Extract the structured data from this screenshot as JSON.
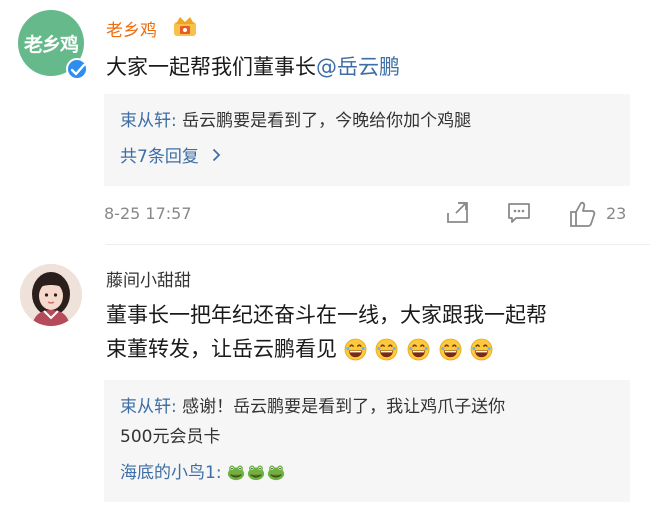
{
  "comments": [
    {
      "username": "老乡鸡",
      "avatar_text": "老乡鸡",
      "content_text": "大家一起帮我们董事长",
      "mention": "@岳云鹏",
      "reply_name": "束从轩:",
      "reply_text": " 岳云鹏要是看到了，今晚给你加个鸡腿",
      "more_replies": "共7条回复",
      "timestamp": "8-25 17:57",
      "like_count": "23"
    },
    {
      "username": "藤间小甜甜",
      "content_line1": "董事长一把年纪还奋斗在一线，大家跟我一起帮",
      "content_line2": "束董转发，让岳云鹏看见",
      "reply_name": "束从轩:",
      "reply_text_line1": " 感谢！岳云鹏要是看到了，我让鸡爪子送你",
      "reply_text_line2": "500元会员卡",
      "reply2_name": "海底的小鸟1:",
      "reply2_text": " "
    }
  ],
  "colors": {
    "brand_orange": "#ef6d0e",
    "link_blue": "#3d6ea6",
    "avatar_green": "#66b98a",
    "verified_blue": "#2d8ef0"
  },
  "icons": [
    "crown-badge-icon",
    "verified-icon",
    "share-icon",
    "comment-icon",
    "like-icon",
    "laugh-emoji-icon",
    "frog-emoji-icon"
  ]
}
